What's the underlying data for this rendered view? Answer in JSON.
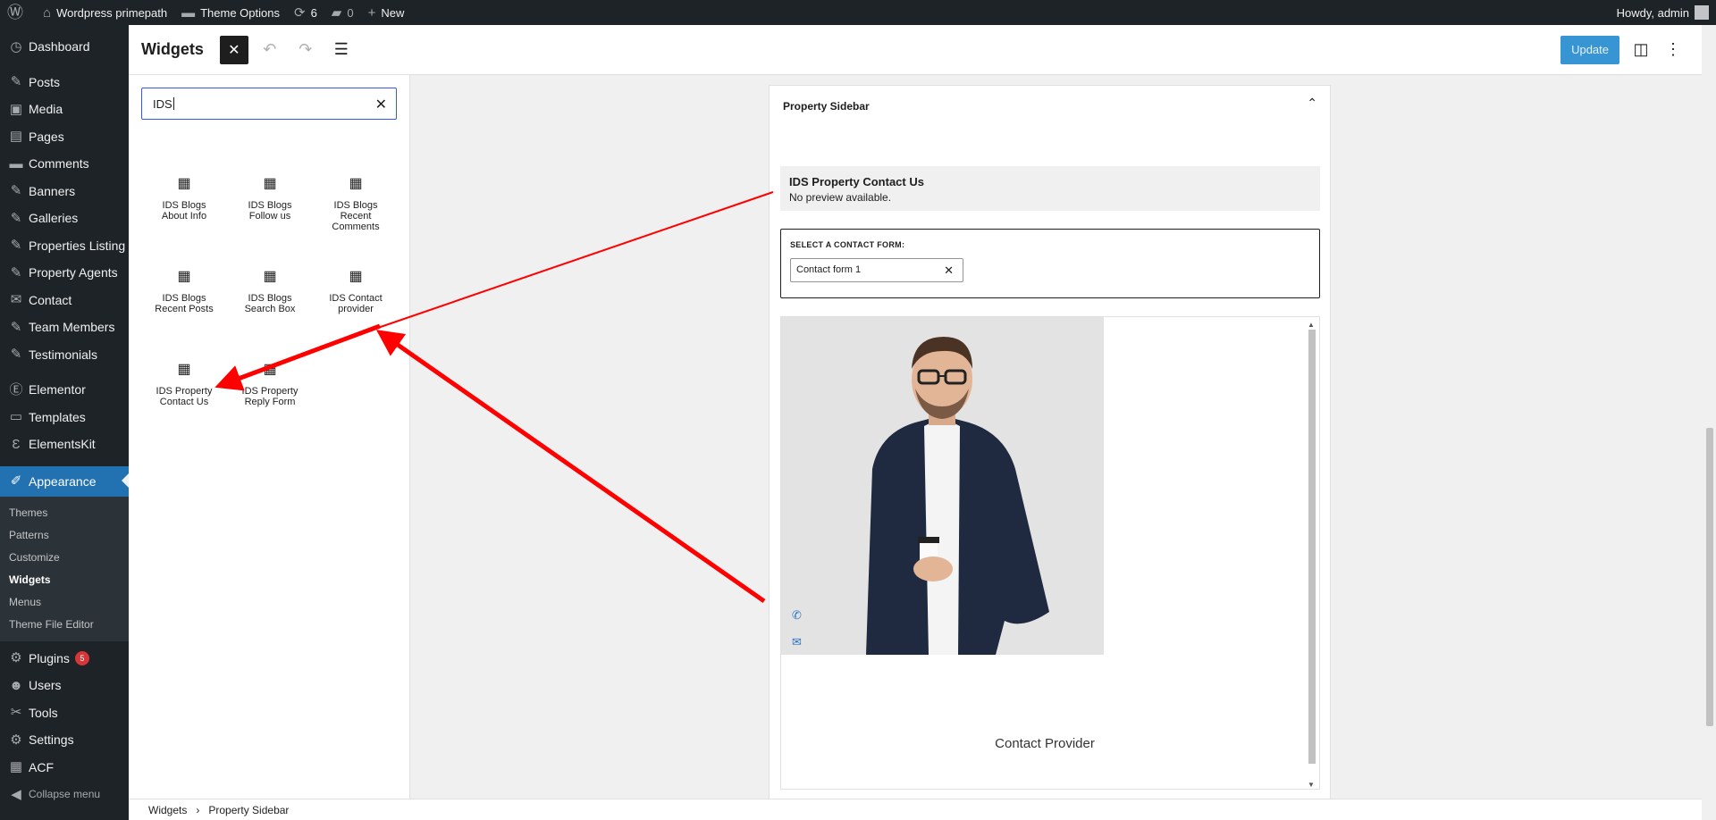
{
  "adminbar": {
    "site_name": "Wordpress primepath",
    "theme_options": "Theme Options",
    "updates_count": "6",
    "comments_count": "0",
    "new_label": "New",
    "howdy": "Howdy, admin"
  },
  "sidebar": {
    "items": [
      {
        "label": "Dashboard",
        "icon": "dashboard-icon",
        "glyph": "◷"
      },
      {
        "label": "Posts",
        "icon": "pin-icon",
        "glyph": "✎"
      },
      {
        "label": "Media",
        "icon": "media-icon",
        "glyph": "▣"
      },
      {
        "label": "Pages",
        "icon": "page-icon",
        "glyph": "▤"
      },
      {
        "label": "Comments",
        "icon": "comment-icon",
        "glyph": "▬"
      },
      {
        "label": "Banners",
        "icon": "pin-icon",
        "glyph": "✎"
      },
      {
        "label": "Galleries",
        "icon": "pin-icon",
        "glyph": "✎"
      },
      {
        "label": "Properties Listing",
        "icon": "pin-icon",
        "glyph": "✎"
      },
      {
        "label": "Property Agents",
        "icon": "pin-icon",
        "glyph": "✎"
      },
      {
        "label": "Contact",
        "icon": "mail-icon",
        "glyph": "✉"
      },
      {
        "label": "Team Members",
        "icon": "pin-icon",
        "glyph": "✎"
      },
      {
        "label": "Testimonials",
        "icon": "pin-icon",
        "glyph": "✎"
      },
      {
        "label": "Elementor",
        "icon": "elementor-icon",
        "glyph": "Ⓔ"
      },
      {
        "label": "Templates",
        "icon": "folder-icon",
        "glyph": "▭"
      },
      {
        "label": "ElementsKit",
        "icon": "elementskit-icon",
        "glyph": "Ɛ"
      },
      {
        "label": "Appearance",
        "icon": "brush-icon",
        "glyph": "✐"
      }
    ],
    "submenu": [
      "Themes",
      "Patterns",
      "Customize",
      "Widgets",
      "Menus",
      "Theme File Editor"
    ],
    "lower_items": [
      {
        "label": "Plugins",
        "icon": "plugin-icon",
        "glyph": "⚙",
        "badge": "5"
      },
      {
        "label": "Users",
        "icon": "user-icon",
        "glyph": "☻"
      },
      {
        "label": "Tools",
        "icon": "wrench-icon",
        "glyph": "✂"
      },
      {
        "label": "Settings",
        "icon": "settings-icon",
        "glyph": "⚙"
      },
      {
        "label": "ACF",
        "icon": "acf-icon",
        "glyph": "▦"
      }
    ],
    "collapse": "Collapse menu"
  },
  "header": {
    "title": "Widgets",
    "update_label": "Update"
  },
  "inserter": {
    "search_value": "IDS",
    "blocks": [
      "IDS Blogs About Info",
      "IDS Blogs Follow us",
      "IDS Blogs Recent Comments",
      "IDS Blogs Recent Posts",
      "IDS Blogs Search Box",
      "IDS Contact provider",
      "IDS Property Contact Us",
      "IDS Property Reply Form"
    ]
  },
  "canvas": {
    "area_title": "Property Sidebar",
    "preview_title": "IDS Property Contact Us",
    "preview_sub": "No preview available.",
    "form_label": "SELECT A CONTACT FORM:",
    "form_value": "Contact form 1",
    "contact_provider": "Contact Provider"
  },
  "breadcrumb": {
    "root": "Widgets",
    "current": "Property Sidebar"
  },
  "colors": {
    "admin_dark": "#1d2327",
    "accent_blue": "#2271b1",
    "update_blue": "#3895d3",
    "arrow_red": "#ff0000"
  }
}
